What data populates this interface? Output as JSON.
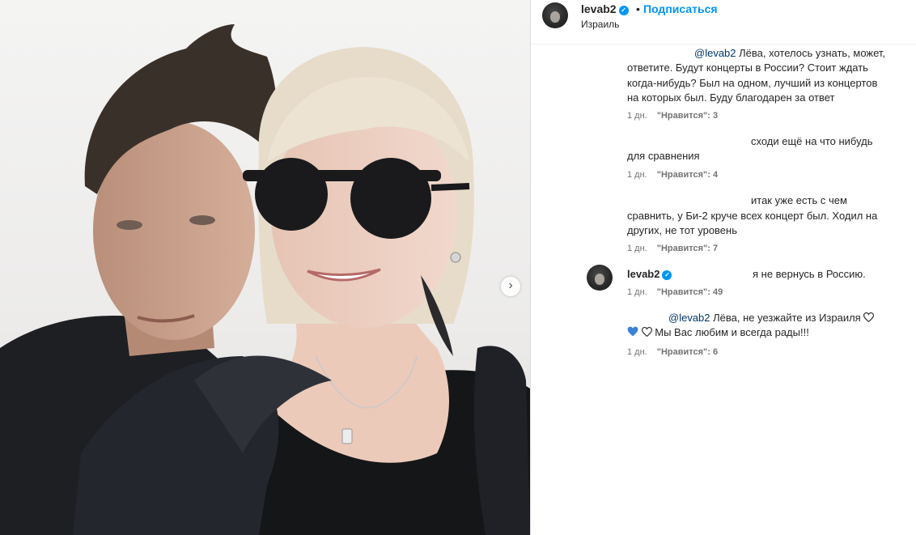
{
  "header": {
    "username": "levab2",
    "separator": "•",
    "follow_label": "Подписаться",
    "location": "Израиль"
  },
  "comments": [
    {
      "mention": "@levab2",
      "lines": [
        "Лёва, хотелось узнать, может,",
        "ответите. Будут концерты в России? Стоит ждать",
        "когда-нибудь? Был на одном, лучший из концертов",
        "на которых был. Буду благодарен за ответ"
      ],
      "age": "1 дн.",
      "likes": "\"Нравится\": 3"
    },
    {
      "lines": [
        "сходи ещё на что нибудь",
        "для сравнения"
      ],
      "age": "1 дн.",
      "likes": "\"Нравится\": 4"
    },
    {
      "lines": [
        "итак уже есть с чем",
        "сравнить, у Би-2 круче всех концерт был. Ходил на",
        "других, не тот уровень"
      ],
      "age": "1 дн.",
      "likes": "\"Нравится\": 7"
    },
    {
      "username": "levab2",
      "text": "я не вернусь в Россию.",
      "age": "1 дн.",
      "likes": "\"Нравится\": 49"
    },
    {
      "mention": "@levab2",
      "line1": "Лёва, не уезжайте из Израиля",
      "line2": "Мы Вас любим и всегда рады!!!",
      "age": "1 дн.",
      "likes": "\"Нравится\": 6"
    }
  ],
  "icons": {
    "next": "chevron-right-icon",
    "verified": "verified-badge-icon",
    "heart_outline": "white-heart-icon",
    "heart_blue": "blue-heart-icon"
  },
  "colors": {
    "accent": "#0095f6",
    "mention": "#00376b",
    "muted": "#737373",
    "text": "#262626"
  }
}
